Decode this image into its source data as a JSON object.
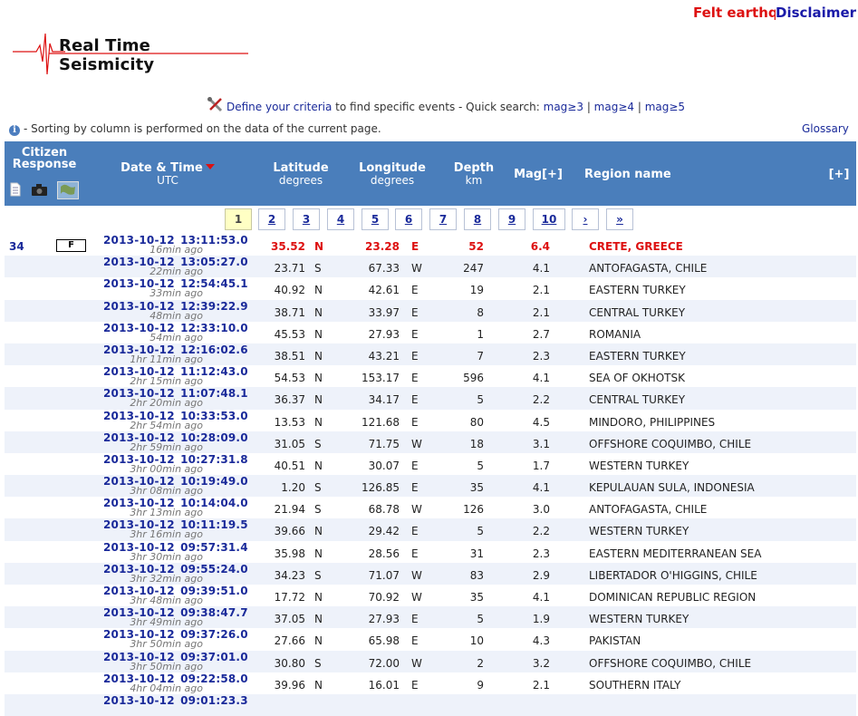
{
  "top_links": {
    "felt": "Felt earthquakes",
    "disclaimer": "Disclaimer"
  },
  "logo": {
    "title": "Real Time Seismicity"
  },
  "criteria": {
    "define_link": "Define your criteria",
    "text": " to find specific events - Quick search: ",
    "quick": [
      "mag≥3",
      "mag≥4",
      "mag≥5"
    ],
    "sep": " | "
  },
  "info": {
    "text": "- Sorting by column is performed on the data of the current page.",
    "glossary": "Glossary"
  },
  "header": {
    "citizen": "Citizen Response",
    "datetime": "Date & Time",
    "datetime_sub": "UTC",
    "latitude": "Latitude",
    "latitude_sub": "degrees",
    "longitude": "Longitude",
    "longitude_sub": "degrees",
    "depth": "Depth",
    "depth_sub": "km",
    "mag": "Mag[+]",
    "region": "Region name",
    "expand": "[+]",
    "icons": [
      "document-icon",
      "camera-icon",
      "map-icon"
    ]
  },
  "pagination": {
    "pages": [
      "1",
      "2",
      "3",
      "4",
      "5",
      "6",
      "7",
      "8",
      "9",
      "10"
    ],
    "current": "1",
    "next": "›",
    "last": "»"
  },
  "events": [
    {
      "id": "34",
      "felt": "F",
      "date": "2013-10-12  13:11:53.0",
      "ago": "16min ago",
      "lat": "35.52",
      "ns": "N",
      "lon": "23.28",
      "ew": "E",
      "depth": "52",
      "mag": "6.4",
      "region": "CRETE, GREECE",
      "highlight": true
    },
    {
      "date": "2013-10-12  13:05:27.0",
      "ago": "22min ago",
      "lat": "23.71",
      "ns": "S",
      "lon": "67.33",
      "ew": "W",
      "depth": "247",
      "mag": "4.1",
      "region": "ANTOFAGASTA, CHILE"
    },
    {
      "date": "2013-10-12  12:54:45.1",
      "ago": "33min ago",
      "lat": "40.92",
      "ns": "N",
      "lon": "42.61",
      "ew": "E",
      "depth": "19",
      "mag": "2.1",
      "region": "EASTERN TURKEY"
    },
    {
      "date": "2013-10-12  12:39:22.9",
      "ago": "48min ago",
      "lat": "38.71",
      "ns": "N",
      "lon": "33.97",
      "ew": "E",
      "depth": "8",
      "mag": "2.1",
      "region": "CENTRAL TURKEY"
    },
    {
      "date": "2013-10-12  12:33:10.0",
      "ago": "54min ago",
      "lat": "45.53",
      "ns": "N",
      "lon": "27.93",
      "ew": "E",
      "depth": "1",
      "mag": "2.7",
      "region": "ROMANIA"
    },
    {
      "date": "2013-10-12  12:16:02.6",
      "ago": "1hr 11min ago",
      "lat": "38.51",
      "ns": "N",
      "lon": "43.21",
      "ew": "E",
      "depth": "7",
      "mag": "2.3",
      "region": "EASTERN TURKEY"
    },
    {
      "date": "2013-10-12  11:12:43.0",
      "ago": "2hr 15min ago",
      "lat": "54.53",
      "ns": "N",
      "lon": "153.17",
      "ew": "E",
      "depth": "596",
      "mag": "4.1",
      "region": "SEA OF OKHOTSK"
    },
    {
      "date": "2013-10-12  11:07:48.1",
      "ago": "2hr 20min ago",
      "lat": "36.37",
      "ns": "N",
      "lon": "34.17",
      "ew": "E",
      "depth": "5",
      "mag": "2.2",
      "region": "CENTRAL TURKEY"
    },
    {
      "date": "2013-10-12  10:33:53.0",
      "ago": "2hr 54min ago",
      "lat": "13.53",
      "ns": "N",
      "lon": "121.68",
      "ew": "E",
      "depth": "80",
      "mag": "4.5",
      "region": "MINDORO, PHILIPPINES"
    },
    {
      "date": "2013-10-12  10:28:09.0",
      "ago": "2hr 59min ago",
      "lat": "31.05",
      "ns": "S",
      "lon": "71.75",
      "ew": "W",
      "depth": "18",
      "mag": "3.1",
      "region": "OFFSHORE COQUIMBO, CHILE"
    },
    {
      "date": "2013-10-12  10:27:31.8",
      "ago": "3hr 00min ago",
      "lat": "40.51",
      "ns": "N",
      "lon": "30.07",
      "ew": "E",
      "depth": "5",
      "mag": "1.7",
      "region": "WESTERN TURKEY"
    },
    {
      "date": "2013-10-12  10:19:49.0",
      "ago": "3hr 08min ago",
      "lat": "1.20",
      "ns": "S",
      "lon": "126.85",
      "ew": "E",
      "depth": "35",
      "mag": "4.1",
      "region": "KEPULAUAN SULA, INDONESIA"
    },
    {
      "date": "2013-10-12  10:14:04.0",
      "ago": "3hr 13min ago",
      "lat": "21.94",
      "ns": "S",
      "lon": "68.78",
      "ew": "W",
      "depth": "126",
      "mag": "3.0",
      "region": "ANTOFAGASTA, CHILE"
    },
    {
      "date": "2013-10-12  10:11:19.5",
      "ago": "3hr 16min ago",
      "lat": "39.66",
      "ns": "N",
      "lon": "29.42",
      "ew": "E",
      "depth": "5",
      "mag": "2.2",
      "region": "WESTERN TURKEY"
    },
    {
      "date": "2013-10-12  09:57:31.4",
      "ago": "3hr 30min ago",
      "lat": "35.98",
      "ns": "N",
      "lon": "28.56",
      "ew": "E",
      "depth": "31",
      "mag": "2.3",
      "region": "EASTERN MEDITERRANEAN SEA"
    },
    {
      "date": "2013-10-12  09:55:24.0",
      "ago": "3hr 32min ago",
      "lat": "34.23",
      "ns": "S",
      "lon": "71.07",
      "ew": "W",
      "depth": "83",
      "mag": "2.9",
      "region": "LIBERTADOR O'HIGGINS, CHILE"
    },
    {
      "date": "2013-10-12  09:39:51.0",
      "ago": "3hr 48min ago",
      "lat": "17.72",
      "ns": "N",
      "lon": "70.92",
      "ew": "W",
      "depth": "35",
      "mag": "4.1",
      "region": "DOMINICAN REPUBLIC REGION"
    },
    {
      "date": "2013-10-12  09:38:47.7",
      "ago": "3hr 49min ago",
      "lat": "37.05",
      "ns": "N",
      "lon": "27.93",
      "ew": "E",
      "depth": "5",
      "mag": "1.9",
      "region": "WESTERN TURKEY"
    },
    {
      "date": "2013-10-12  09:37:26.0",
      "ago": "3hr 50min ago",
      "lat": "27.66",
      "ns": "N",
      "lon": "65.98",
      "ew": "E",
      "depth": "10",
      "mag": "4.3",
      "region": "PAKISTAN"
    },
    {
      "date": "2013-10-12  09:37:01.0",
      "ago": "3hr 50min ago",
      "lat": "30.80",
      "ns": "S",
      "lon": "72.00",
      "ew": "W",
      "depth": "2",
      "mag": "3.2",
      "region": "OFFSHORE COQUIMBO, CHILE"
    },
    {
      "date": "2013-10-12  09:22:58.0",
      "ago": "4hr 04min ago",
      "lat": "39.96",
      "ns": "N",
      "lon": "16.01",
      "ew": "E",
      "depth": "9",
      "mag": "2.1",
      "region": "SOUTHERN ITALY"
    },
    {
      "date": "2013-10-12  09:01:23.3",
      "ago": "",
      "lat": "",
      "ns": "",
      "lon": "",
      "ew": "",
      "depth": "",
      "mag": "",
      "region": ""
    }
  ]
}
